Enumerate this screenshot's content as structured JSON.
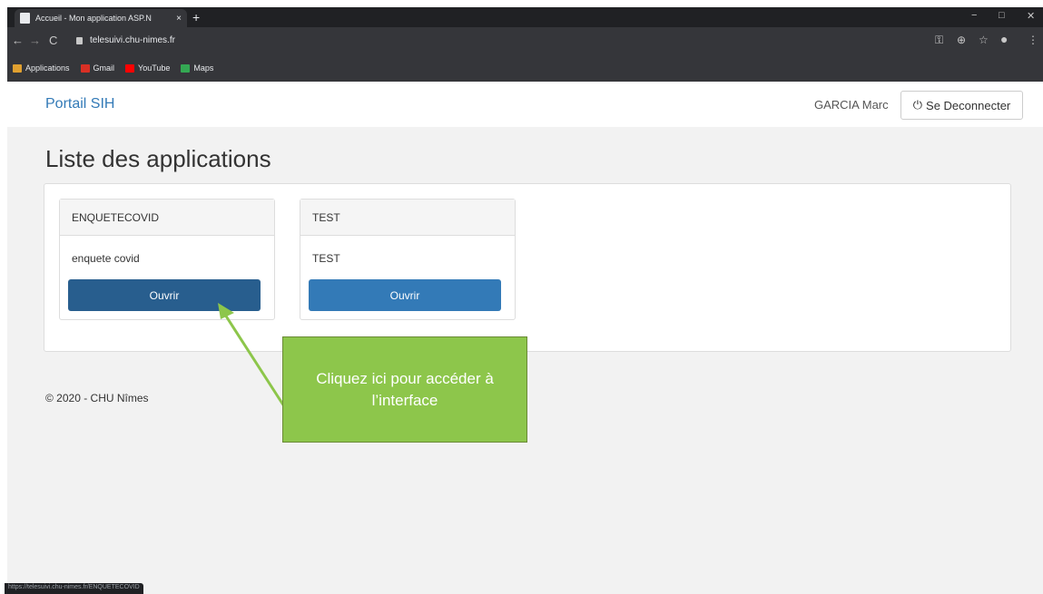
{
  "browser": {
    "tab_title": "Accueil - Mon application ASP.N",
    "tab_close": "×",
    "new_tab": "+",
    "url": "telesuivi.chu-nimes.fr",
    "controls": {
      "minimize": "−",
      "maximize": "□",
      "close": "✕"
    },
    "bookmarks": [
      {
        "label": "Applications",
        "color": "#e0a030"
      },
      {
        "label": "Gmail",
        "color": "#d93025"
      },
      {
        "label": "YouTube",
        "color": "#ff0000"
      },
      {
        "label": "Maps",
        "color": "#34a853"
      }
    ],
    "status_url": "https://telesuivi.chu-nimes.fr/ENQUETECOVID"
  },
  "navbar": {
    "brand": "Portail SIH",
    "user": "GARCIA Marc",
    "logout_label": "Se Deconnecter"
  },
  "page": {
    "title": "Liste des applications",
    "apps": [
      {
        "name": "ENQUETECOVID",
        "description": "enquete covid",
        "button": "Ouvrir",
        "button_color": "#285e8e"
      },
      {
        "name": "TEST",
        "description": "TEST",
        "button": "Ouvrir",
        "button_color": "#337ab7"
      }
    ],
    "footer": "© 2020 - CHU Nîmes"
  },
  "callout": {
    "line1": "Cliquez ici pour accéder à",
    "line2": "l’interface",
    "color": "#8dc64b"
  }
}
